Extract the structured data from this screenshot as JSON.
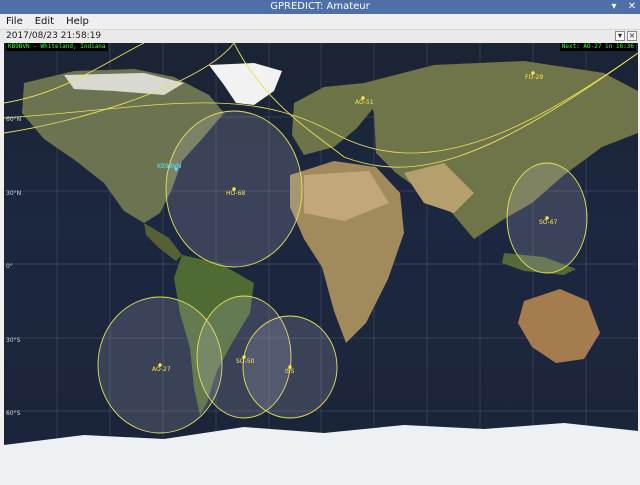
{
  "window": {
    "title": "GPREDICT: Amateur",
    "buttons": [
      "▾",
      "✕"
    ]
  },
  "menu": {
    "file": "File",
    "edit": "Edit",
    "help": "Help"
  },
  "timebar": {
    "datetime": "2017/08/23 21:58:19"
  },
  "map": {
    "qth_label": "KB9BVN - Whiteland, Indiana",
    "next_label": "Next: AO-27 in 16:36",
    "lat_labels": [
      "60°N",
      "30°N",
      "0°",
      "30°S",
      "60°S"
    ],
    "ground_station": "KB9BVN",
    "satellites": [
      {
        "name": "HO-68"
      },
      {
        "name": "AO-51"
      },
      {
        "name": "FO-29"
      },
      {
        "name": "SO-67"
      },
      {
        "name": "AO-27"
      },
      {
        "name": "SO-50"
      },
      {
        "name": "ISS"
      }
    ]
  }
}
